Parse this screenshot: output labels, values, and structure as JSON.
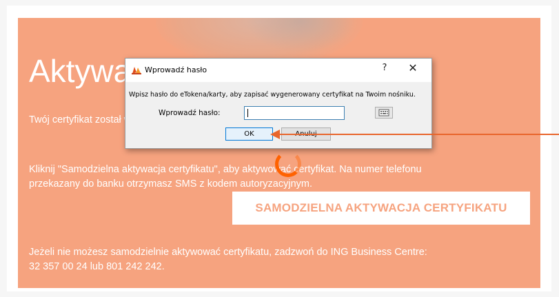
{
  "page": {
    "hero_title": "Aktywacja certyfikatu",
    "status_line": "Twój certyfikat został wygenerowany.",
    "instruction_line1": "Kliknij \"Samodzielna aktywacja certyfikatu\", aby aktywować certyfikat. Na numer telefonu",
    "instruction_line2": "przekazany do banku otrzymasz SMS z kodem autoryzacyjnym.",
    "cta_label": "SAMODZIELNA AKTYWACJA CERTYFIKATU",
    "help_line1": "Jeżeli nie możesz samodzielnie aktywować certyfikatu, zadzwoń do ING Business Centre:",
    "help_line2": "32 357 00 24 lub 801 242 242."
  },
  "dialog": {
    "title": "Wprowadź hasło",
    "help_glyph": "?",
    "close_glyph": "✕",
    "message": "Wpisz hasło do eTokena/karty, aby zapisać wygenerowany certyfikat na Twoim nośniku.",
    "password_label": "Wprowadź hasło:",
    "password_value": "",
    "ok_label": "OK",
    "cancel_label": "Anuluj",
    "keyboard_icon": "keyboard-icon"
  },
  "colors": {
    "hero_bg": "#f6a37f",
    "accent": "#ff6200",
    "arrow": "#e8652b"
  }
}
